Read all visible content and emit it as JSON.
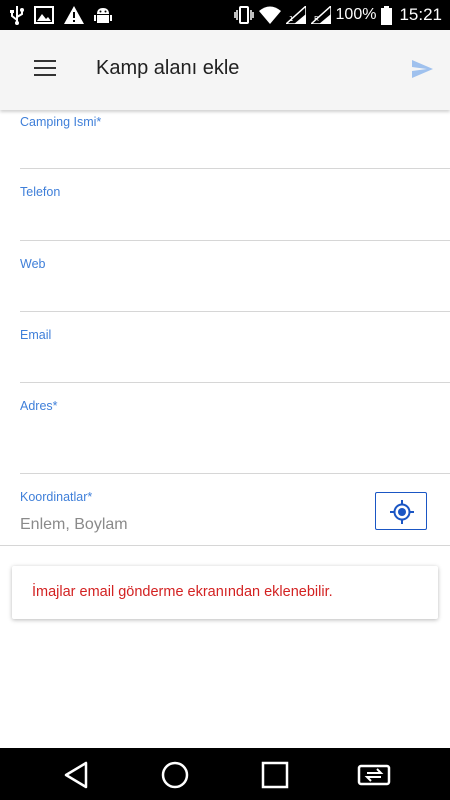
{
  "status_bar": {
    "battery": "100%",
    "time": "15:21",
    "icons": [
      "usb-icon",
      "image-icon",
      "alert-icon",
      "android-debug-icon",
      "vibrate-icon",
      "wifi-icon",
      "signal-icon",
      "signal-roaming-icon",
      "battery-icon"
    ]
  },
  "app_bar": {
    "title": "Kamp alanı ekle",
    "menu_icon": "hamburger-menu-icon",
    "send_icon": "send-icon"
  },
  "form": {
    "name": {
      "label": "Camping Ismi*",
      "value": ""
    },
    "phone": {
      "label": "Telefon",
      "value": ""
    },
    "web": {
      "label": "Web",
      "value": ""
    },
    "email": {
      "label": "Email",
      "value": ""
    },
    "address": {
      "label": "Adres*",
      "value": ""
    },
    "coordinates": {
      "label": "Koordinatlar*",
      "value": "",
      "placeholder": "Enlem, Boylam",
      "button_icon": "gps-locate-icon"
    }
  },
  "info_message": "İmajlar email gönderme ekranından eklenebilir.",
  "nav_bar": {
    "icons": [
      "back-icon",
      "home-icon",
      "recents-icon",
      "switch-app-icon"
    ]
  },
  "colors": {
    "accent": "#3f7fd9",
    "gps_button_border": "#1a56c4",
    "send_icon": "#9fc1ee",
    "error_text": "#d32222",
    "appbar_bg": "#f5f5f5"
  }
}
